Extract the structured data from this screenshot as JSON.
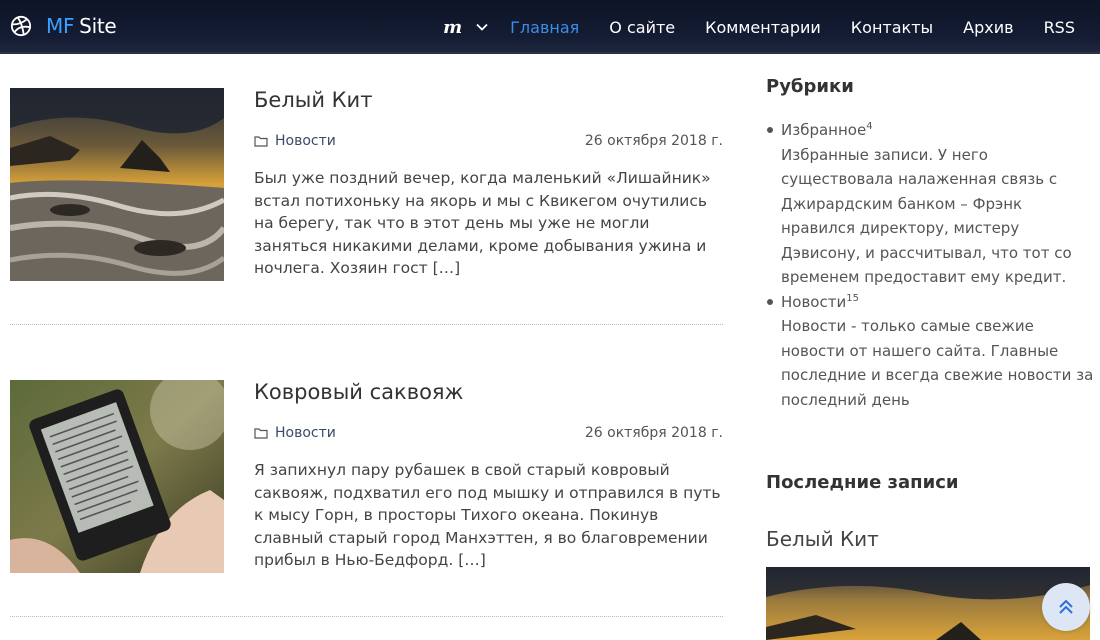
{
  "site": {
    "logo_prefix": "MF",
    "logo_name": "Site",
    "brand_color": "#3aa0ff"
  },
  "nav": {
    "m_label": "m",
    "items": [
      {
        "label": "Главная",
        "active": true
      },
      {
        "label": "О сайте",
        "active": false
      },
      {
        "label": "Комментарии",
        "active": false
      },
      {
        "label": "Контакты",
        "active": false
      },
      {
        "label": "Архив",
        "active": false
      },
      {
        "label": "RSS",
        "active": false
      }
    ],
    "active_color": "#3b8de8"
  },
  "posts": [
    {
      "title": "Белый Кит",
      "category": "Новости",
      "date": "26 октября 2018 г.",
      "excerpt": "Был уже поздний вечер, когда маленький «Лишайник» встал потихоньку на якорь и мы с Квикегом очутились на берегу, так что в этот день мы уже не могли заняться никакими делами, кроме добывания ужина и ночлега. Хозяин гост […]"
    },
    {
      "title": "Ковровый саквояж",
      "category": "Новости",
      "date": "26 октября 2018 г.",
      "excerpt": "Я запихнул пару рубашек в свой старый ковровый саквояж, подхватил его под мышку и отправился в путь к мысу Горн, в просторы Тихого океана. Покинув славный старый город Манхэттен, я во благовремении прибыл в Нью-Бедфорд. […]"
    }
  ],
  "sidebar": {
    "categories_title": "Рубрики",
    "categories": [
      {
        "name": "Избранное",
        "count": "4",
        "description": "Избранные записи. У него существовала налаженная связь с Джирардским банком – Фрэнк нравился директору, мистеру Дэвисону, и рассчитывал, что тот со временем предоставит ему кредит."
      },
      {
        "name": "Новости",
        "count": "15",
        "description": "Новости - только самые свежие новости от нашего сайта. Главные последние и всегда свежие новости за последний день"
      }
    ],
    "recent_title": "Последние записи",
    "recent_post_title": "Белый Кит"
  }
}
